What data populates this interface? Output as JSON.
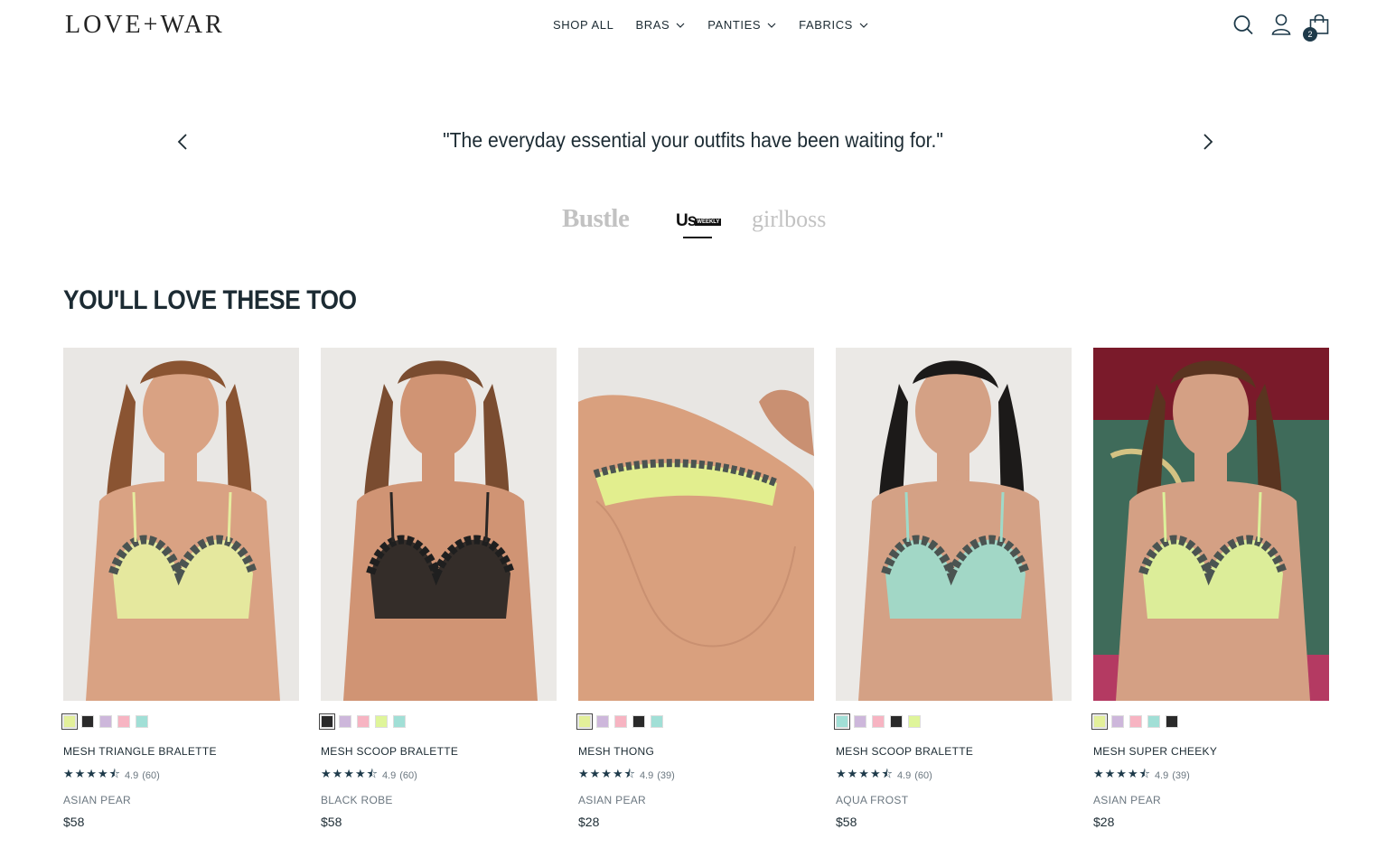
{
  "brand": {
    "logo_text": "LOVE+WAR"
  },
  "nav": {
    "items": [
      {
        "label": "SHOP ALL",
        "has_dropdown": false
      },
      {
        "label": "BRAS",
        "has_dropdown": true
      },
      {
        "label": "PANTIES",
        "has_dropdown": true
      },
      {
        "label": "FABRICS",
        "has_dropdown": true
      }
    ]
  },
  "header_icons": {
    "search": "search-icon",
    "account": "user-icon",
    "cart": "bag-icon",
    "cart_count": "2"
  },
  "testimonial": {
    "quote": "\"The everyday essential your outfits have been waiting for.\"",
    "prev_icon": "chevron-left-icon",
    "next_icon": "chevron-right-icon"
  },
  "press": {
    "logos": [
      "Bustle",
      "Us",
      "girlboss"
    ],
    "us_weekly_text": "WEEKLY",
    "active": "Us"
  },
  "section": {
    "title": "YOU'LL LOVE THESE TOO"
  },
  "colors": {
    "asian_pear": "#e3f09a",
    "black_robe": "#2a2a2a",
    "lilac": "#cdb7db",
    "pink": "#f7b4c2",
    "aqua_frost": "#a1dfd6",
    "lime": "#dff59a"
  },
  "products": [
    {
      "name": "MESH TRIANGLE BRALETTE",
      "rating": "4.9",
      "reviews": "(60)",
      "color": "ASIAN PEAR",
      "price": "$58",
      "swatches": [
        "#e3f09a",
        "#2a2a2a",
        "#cdb7db",
        "#f7b4c2",
        "#a1dfd6"
      ],
      "selected": 0,
      "image": {
        "bg": "#e9e7e4",
        "skin": "#d9a283",
        "garment": "#e6ec9f",
        "lace": "#4b5451",
        "hair": "#8a5432"
      }
    },
    {
      "name": "MESH SCOOP BRALETTE",
      "rating": "4.9",
      "reviews": "(60)",
      "color": "BLACK ROBE",
      "price": "$58",
      "swatches": [
        "#2a2a2a",
        "#cdb7db",
        "#f7b4c2",
        "#dff59a",
        "#a1dfd6"
      ],
      "selected": 0,
      "image": {
        "bg": "#ebe9e6",
        "skin": "#d09474",
        "garment": "#2b2725",
        "lace": "#1f1f1f",
        "hair": "#7a4c30"
      }
    },
    {
      "name": "MESH THONG",
      "rating": "4.9",
      "reviews": "(39)",
      "color": "ASIAN PEAR",
      "price": "$28",
      "swatches": [
        "#e3f09a",
        "#cdb7db",
        "#f7b4c2",
        "#2a2a2a",
        "#a1dfd6"
      ],
      "selected": 0,
      "image": {
        "bg": "#e8e6e3",
        "skin": "#d9a07e",
        "garment": "#e2ee8e",
        "lace": "#4b5451",
        "hair": "#000000"
      }
    },
    {
      "name": "MESH SCOOP BRALETTE",
      "rating": "4.9",
      "reviews": "(60)",
      "color": "AQUA FROST",
      "price": "$58",
      "swatches": [
        "#a1dfd6",
        "#cdb7db",
        "#f7b4c2",
        "#2a2a2a",
        "#dff59a"
      ],
      "selected": 0,
      "image": {
        "bg": "#ebe9e6",
        "skin": "#d4a185",
        "garment": "#9fdac9",
        "lace": "#4b5451",
        "hair": "#1c1a19"
      }
    },
    {
      "name": "MESH SUPER CHEEKY",
      "rating": "4.9",
      "reviews": "(39)",
      "color": "ASIAN PEAR",
      "price": "$28",
      "swatches": [
        "#e3f09a",
        "#cdb7db",
        "#f7b4c2",
        "#a1dfd6",
        "#2a2a2a"
      ],
      "selected": 0,
      "image": {
        "bg": "#7a1a2a",
        "skin": "#d4a084",
        "garment": "#dcf19a",
        "lace": "#4b5451",
        "hair": "#5a3420"
      }
    }
  ]
}
